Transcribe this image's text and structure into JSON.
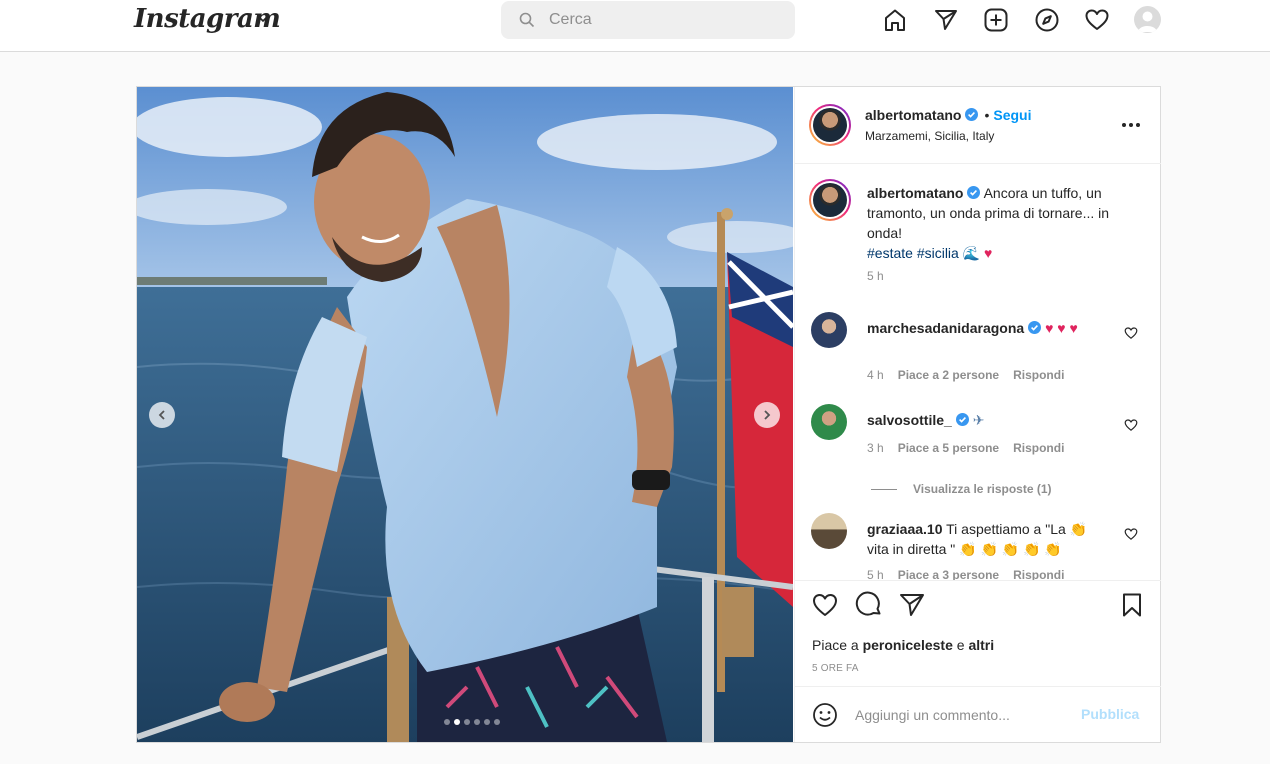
{
  "nav": {
    "logo": "Instagram",
    "search_placeholder": "Cerca",
    "icons": [
      "home-icon",
      "direct-icon",
      "new-post-icon",
      "explore-icon",
      "activity-icon",
      "profile-avatar"
    ]
  },
  "post": {
    "username": "albertomatano",
    "separator": "•",
    "follow_label": "Segui",
    "location": "Marzamemi, Sicilia, Italy",
    "caption": {
      "username": "albertomatano",
      "text": "Ancora un tuffo, un tramonto, un onda prima di tornare... in onda!",
      "hashtags": "#estate #sicilia",
      "emojis": "🌊 ♥",
      "time": "5 h"
    },
    "comments": [
      {
        "username": "marchesadanidaragona",
        "text": "♥ ♥ ♥",
        "time": "4 h",
        "likes": "Piace a 2 persone",
        "reply": "Rispondi"
      },
      {
        "username": "salvosottile_",
        "text": "✈",
        "time": "3 h",
        "likes": "Piace a 5 persone",
        "reply": "Rispondi"
      },
      {
        "username": "graziaaa.10",
        "text": "Ti aspettiamo a \"La 👏 vita in diretta \" 👏 👏 👏 👏 👏",
        "time": "5 h",
        "likes": "Piace a 3 persone",
        "reply": "Rispondi"
      }
    ],
    "view_replies": "Visualizza le risposte (1)",
    "liked_by_prefix": "Piace a",
    "liked_by_user": "peroniceleste",
    "liked_by_conj": "e",
    "liked_by_others": "altri",
    "date": "5 ORE FA",
    "comment_placeholder": "Aggiungi un commento...",
    "publish_label": "Pubblica",
    "carousel_count": 6,
    "carousel_active_index": 1
  },
  "colors": {
    "accent": "#0095f6",
    "verified": "#3897f0",
    "publish_disabled": "#b2dffc",
    "heart": "#e0245e"
  }
}
